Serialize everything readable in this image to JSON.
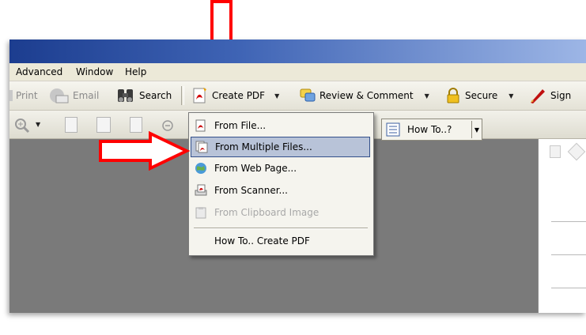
{
  "menubar": {
    "items": [
      "Advanced",
      "Window",
      "Help"
    ]
  },
  "toolbar": {
    "print": "Print",
    "email": "Email",
    "search": "Search",
    "create_pdf": "Create PDF",
    "review": "Review & Comment",
    "secure": "Secure",
    "sign": "Sign",
    "howto": "How To..?"
  },
  "create_pdf_menu": {
    "items": [
      {
        "label": "From File...",
        "state": "normal"
      },
      {
        "label": "From Multiple Files...",
        "state": "highlighted"
      },
      {
        "label": "From Web Page...",
        "state": "normal"
      },
      {
        "label": "From Scanner...",
        "state": "normal"
      },
      {
        "label": "From Clipboard Image",
        "state": "disabled"
      },
      {
        "label": "How To.. Create PDF",
        "state": "normal"
      }
    ]
  },
  "colors": {
    "arrow": "#ff0000",
    "highlight": "#b8c3d8",
    "title_bar": "#1c3d8f"
  },
  "icons": [
    "print-icon",
    "email-icon",
    "search-icon",
    "create-pdf-icon",
    "review-icon",
    "secure-lock-icon",
    "sign-pen-icon",
    "zoom-in-icon",
    "page-icon",
    "zoom-out-icon",
    "howto-icon"
  ]
}
